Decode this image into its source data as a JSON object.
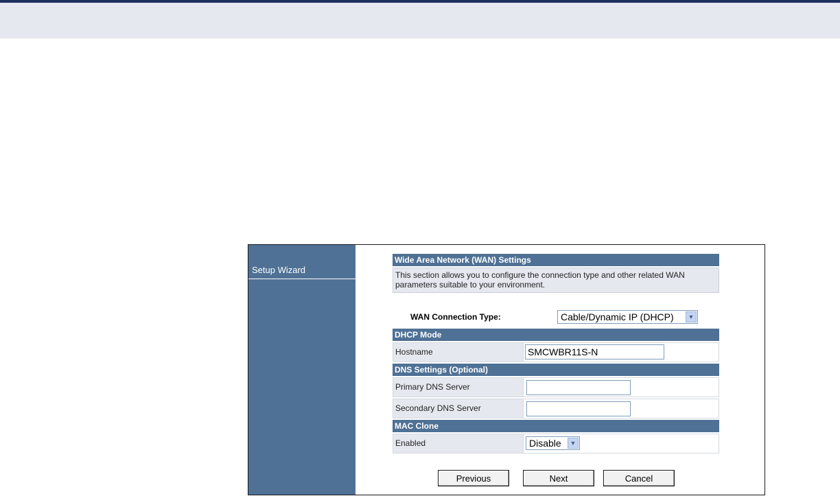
{
  "sidebar": {
    "items": [
      {
        "label": "Setup Wizard"
      }
    ]
  },
  "wan": {
    "section_title": "Wide Area Network (WAN) Settings",
    "description_line1": "This section allows you to configure the connection type and other related WAN",
    "description_line2": "parameters suitable to your environment.",
    "connection_type_label": "WAN Connection Type:",
    "connection_type_value": "Cable/Dynamic IP (DHCP)"
  },
  "dhcp": {
    "section_title": "DHCP Mode",
    "hostname_label": "Hostname",
    "hostname_value": "SMCWBR11S-N"
  },
  "dns": {
    "section_title": "DNS Settings (Optional)",
    "primary_label": "Primary DNS Server",
    "primary_value": "",
    "secondary_label": "Secondary DNS Server",
    "secondary_value": ""
  },
  "mac": {
    "section_title": "MAC Clone",
    "enabled_label": "Enabled",
    "enabled_value": "Disable"
  },
  "buttons": {
    "previous": "Previous",
    "next": "Next",
    "cancel": "Cancel"
  },
  "colors": {
    "header_blue": "#4f7195",
    "top_rule": "#1c2f5e",
    "band_gray": "#e6e8ef"
  }
}
